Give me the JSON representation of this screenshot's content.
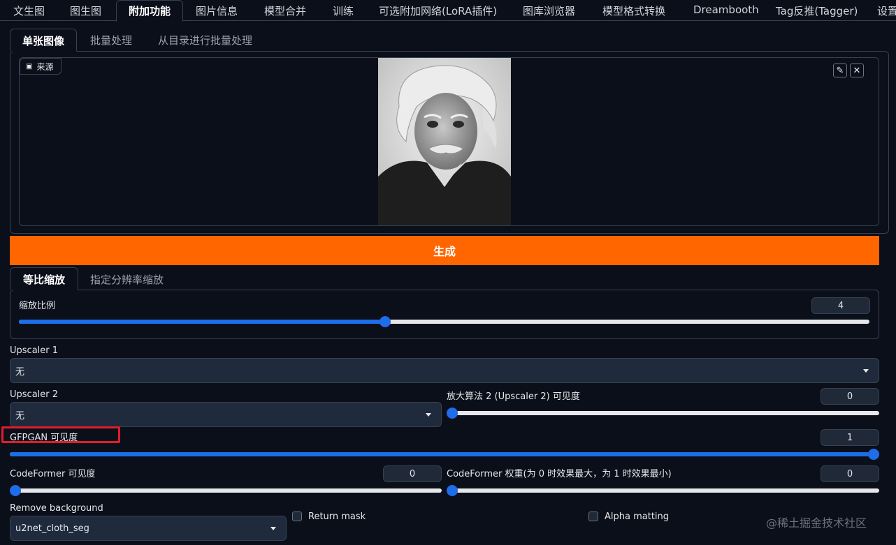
{
  "top_tabs": [
    {
      "label": "文生图"
    },
    {
      "label": "图生图"
    },
    {
      "label": "附加功能",
      "active": true
    },
    {
      "label": "图片信息"
    },
    {
      "label": "模型合并"
    },
    {
      "label": "训练"
    },
    {
      "label": "可选附加网络(LoRA插件)"
    },
    {
      "label": "图库浏览器"
    },
    {
      "label": "模型格式转换"
    },
    {
      "label": "Dreambooth"
    },
    {
      "label": "Tag反推(Tagger)"
    },
    {
      "label": "设置"
    }
  ],
  "source_tabs": [
    {
      "label": "单张图像",
      "active": true
    },
    {
      "label": "批量处理"
    },
    {
      "label": "从目录进行批量处理"
    }
  ],
  "source": {
    "label": "来源",
    "image_icon": "image-icon",
    "edit_icon": "pencil-icon",
    "clear_icon": "close-icon"
  },
  "generate_label": "生成",
  "resize_tabs": [
    {
      "label": "等比缩放",
      "active": true
    },
    {
      "label": "指定分辨率缩放"
    }
  ],
  "scale": {
    "label": "缩放比例",
    "value": "4",
    "min": 1,
    "max": 8,
    "fraction": 0.43
  },
  "upscaler1": {
    "label": "Upscaler 1",
    "value": "无"
  },
  "upscaler2": {
    "label": "Upscaler 2",
    "value": "无"
  },
  "upscaler2_visibility": {
    "label": "放大算法 2 (Upscaler 2) 可见度",
    "value": "0",
    "fraction": 0
  },
  "gfpgan": {
    "label": "GFPGAN 可见度",
    "value": "1",
    "fraction": 1
  },
  "codeformer_visibility": {
    "label": "CodeFormer 可见度",
    "value": "0",
    "fraction": 0
  },
  "codeformer_weight": {
    "label": "CodeFormer 权重(为 0 时效果最大，为 1 时效果最小)",
    "value": "0",
    "fraction": 0
  },
  "remove_bg": {
    "label": "Remove background",
    "value": "u2net_cloth_seg"
  },
  "return_mask": {
    "label": "Return mask",
    "checked": false
  },
  "alpha_matting": {
    "label": "Alpha matting",
    "checked": false
  },
  "watermark": "@稀土掘金技术社区",
  "colors": {
    "accent": "#ff6600",
    "slider": "#1d6ee8",
    "highlight": "#e11d2b",
    "background": "#0b0f19"
  }
}
